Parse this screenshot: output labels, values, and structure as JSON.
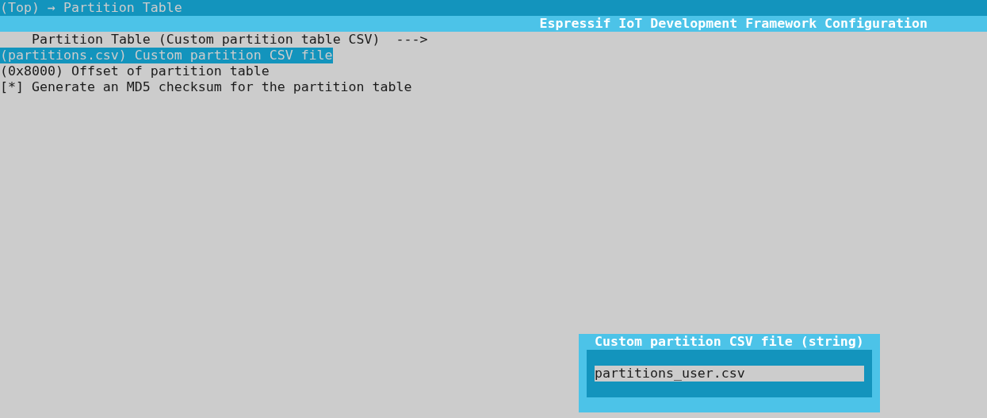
{
  "breadcrumb": "(Top) → Partition Table",
  "title": "Espressif IoT Development Framework Configuration",
  "items": [
    {
      "kind": "menu",
      "text": "Partition Table (Custom partition table CSV)  --->",
      "selected": false
    },
    {
      "kind": "option",
      "text": "(partitions.csv) Custom partition CSV file",
      "selected": true
    },
    {
      "kind": "option",
      "text": "(0x8000) Offset of partition table",
      "selected": false
    },
    {
      "kind": "option",
      "text": "[*] Generate an MD5 checksum for the partition table",
      "selected": false
    }
  ],
  "dialog": {
    "title": "Custom partition CSV file (string)",
    "value": "partitions_user.csv"
  }
}
